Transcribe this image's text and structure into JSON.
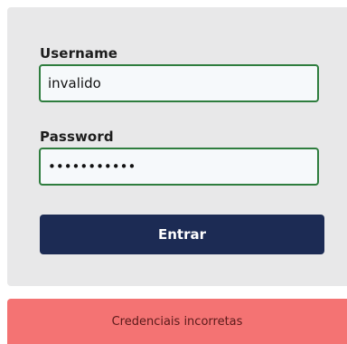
{
  "login_form": {
    "username_label": "Username",
    "username_value": "invalido",
    "password_label": "Password",
    "password_value": "•••••••••••",
    "submit_label": "Entrar"
  },
  "error_banner": {
    "message": "Credenciais incorretas"
  },
  "colors": {
    "card_background": "#e8e8e9",
    "input_border": "#2e7d3e",
    "button_background": "#1c2b54",
    "error_background": "#f47373"
  }
}
